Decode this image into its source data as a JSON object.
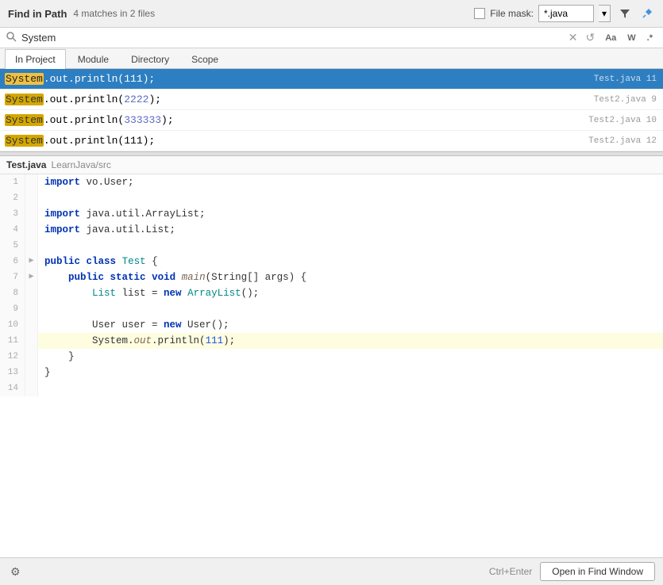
{
  "header": {
    "title": "Find in Path",
    "matches_text": "4 matches in 2 files",
    "file_mask_label": "File mask:",
    "file_mask_value": "*.java",
    "dropdown_arrow": "▾",
    "filter_icon": "filter",
    "pin_icon": "pin"
  },
  "search_bar": {
    "query": "System",
    "clear_icon": "✕",
    "replace_icon": "↺",
    "match_case_label": "Aa",
    "whole_word_label": "W",
    "regex_label": ".*"
  },
  "tabs": [
    {
      "id": "in-project",
      "label": "In Project",
      "active": true
    },
    {
      "id": "module",
      "label": "Module",
      "active": false
    },
    {
      "id": "directory",
      "label": "Directory",
      "active": false
    },
    {
      "id": "scope",
      "label": "Scope",
      "active": false
    }
  ],
  "results": [
    {
      "id": 1,
      "selected": true,
      "prefix": "",
      "keyword": "System",
      "suffix": ".out.println(111);",
      "file": "Test.java",
      "line": "11"
    },
    {
      "id": 2,
      "selected": false,
      "prefix": "",
      "keyword": "System",
      "suffix": ".out.println(2222);",
      "file": "Test2.java",
      "line": "9"
    },
    {
      "id": 3,
      "selected": false,
      "prefix": "",
      "keyword": "System",
      "suffix": ".out.println(333333);",
      "file": "Test2.java",
      "line": "10"
    },
    {
      "id": 4,
      "selected": false,
      "prefix": "",
      "keyword": "System",
      "suffix": ".out.println(111);",
      "file": "Test2.java",
      "line": "12"
    }
  ],
  "code_preview": {
    "file_name": "Test.java",
    "file_path": "LearnJava/src"
  },
  "footer": {
    "shortcut": "Ctrl+Enter",
    "open_button": "Open in Find Window",
    "gear_icon": "⚙"
  }
}
